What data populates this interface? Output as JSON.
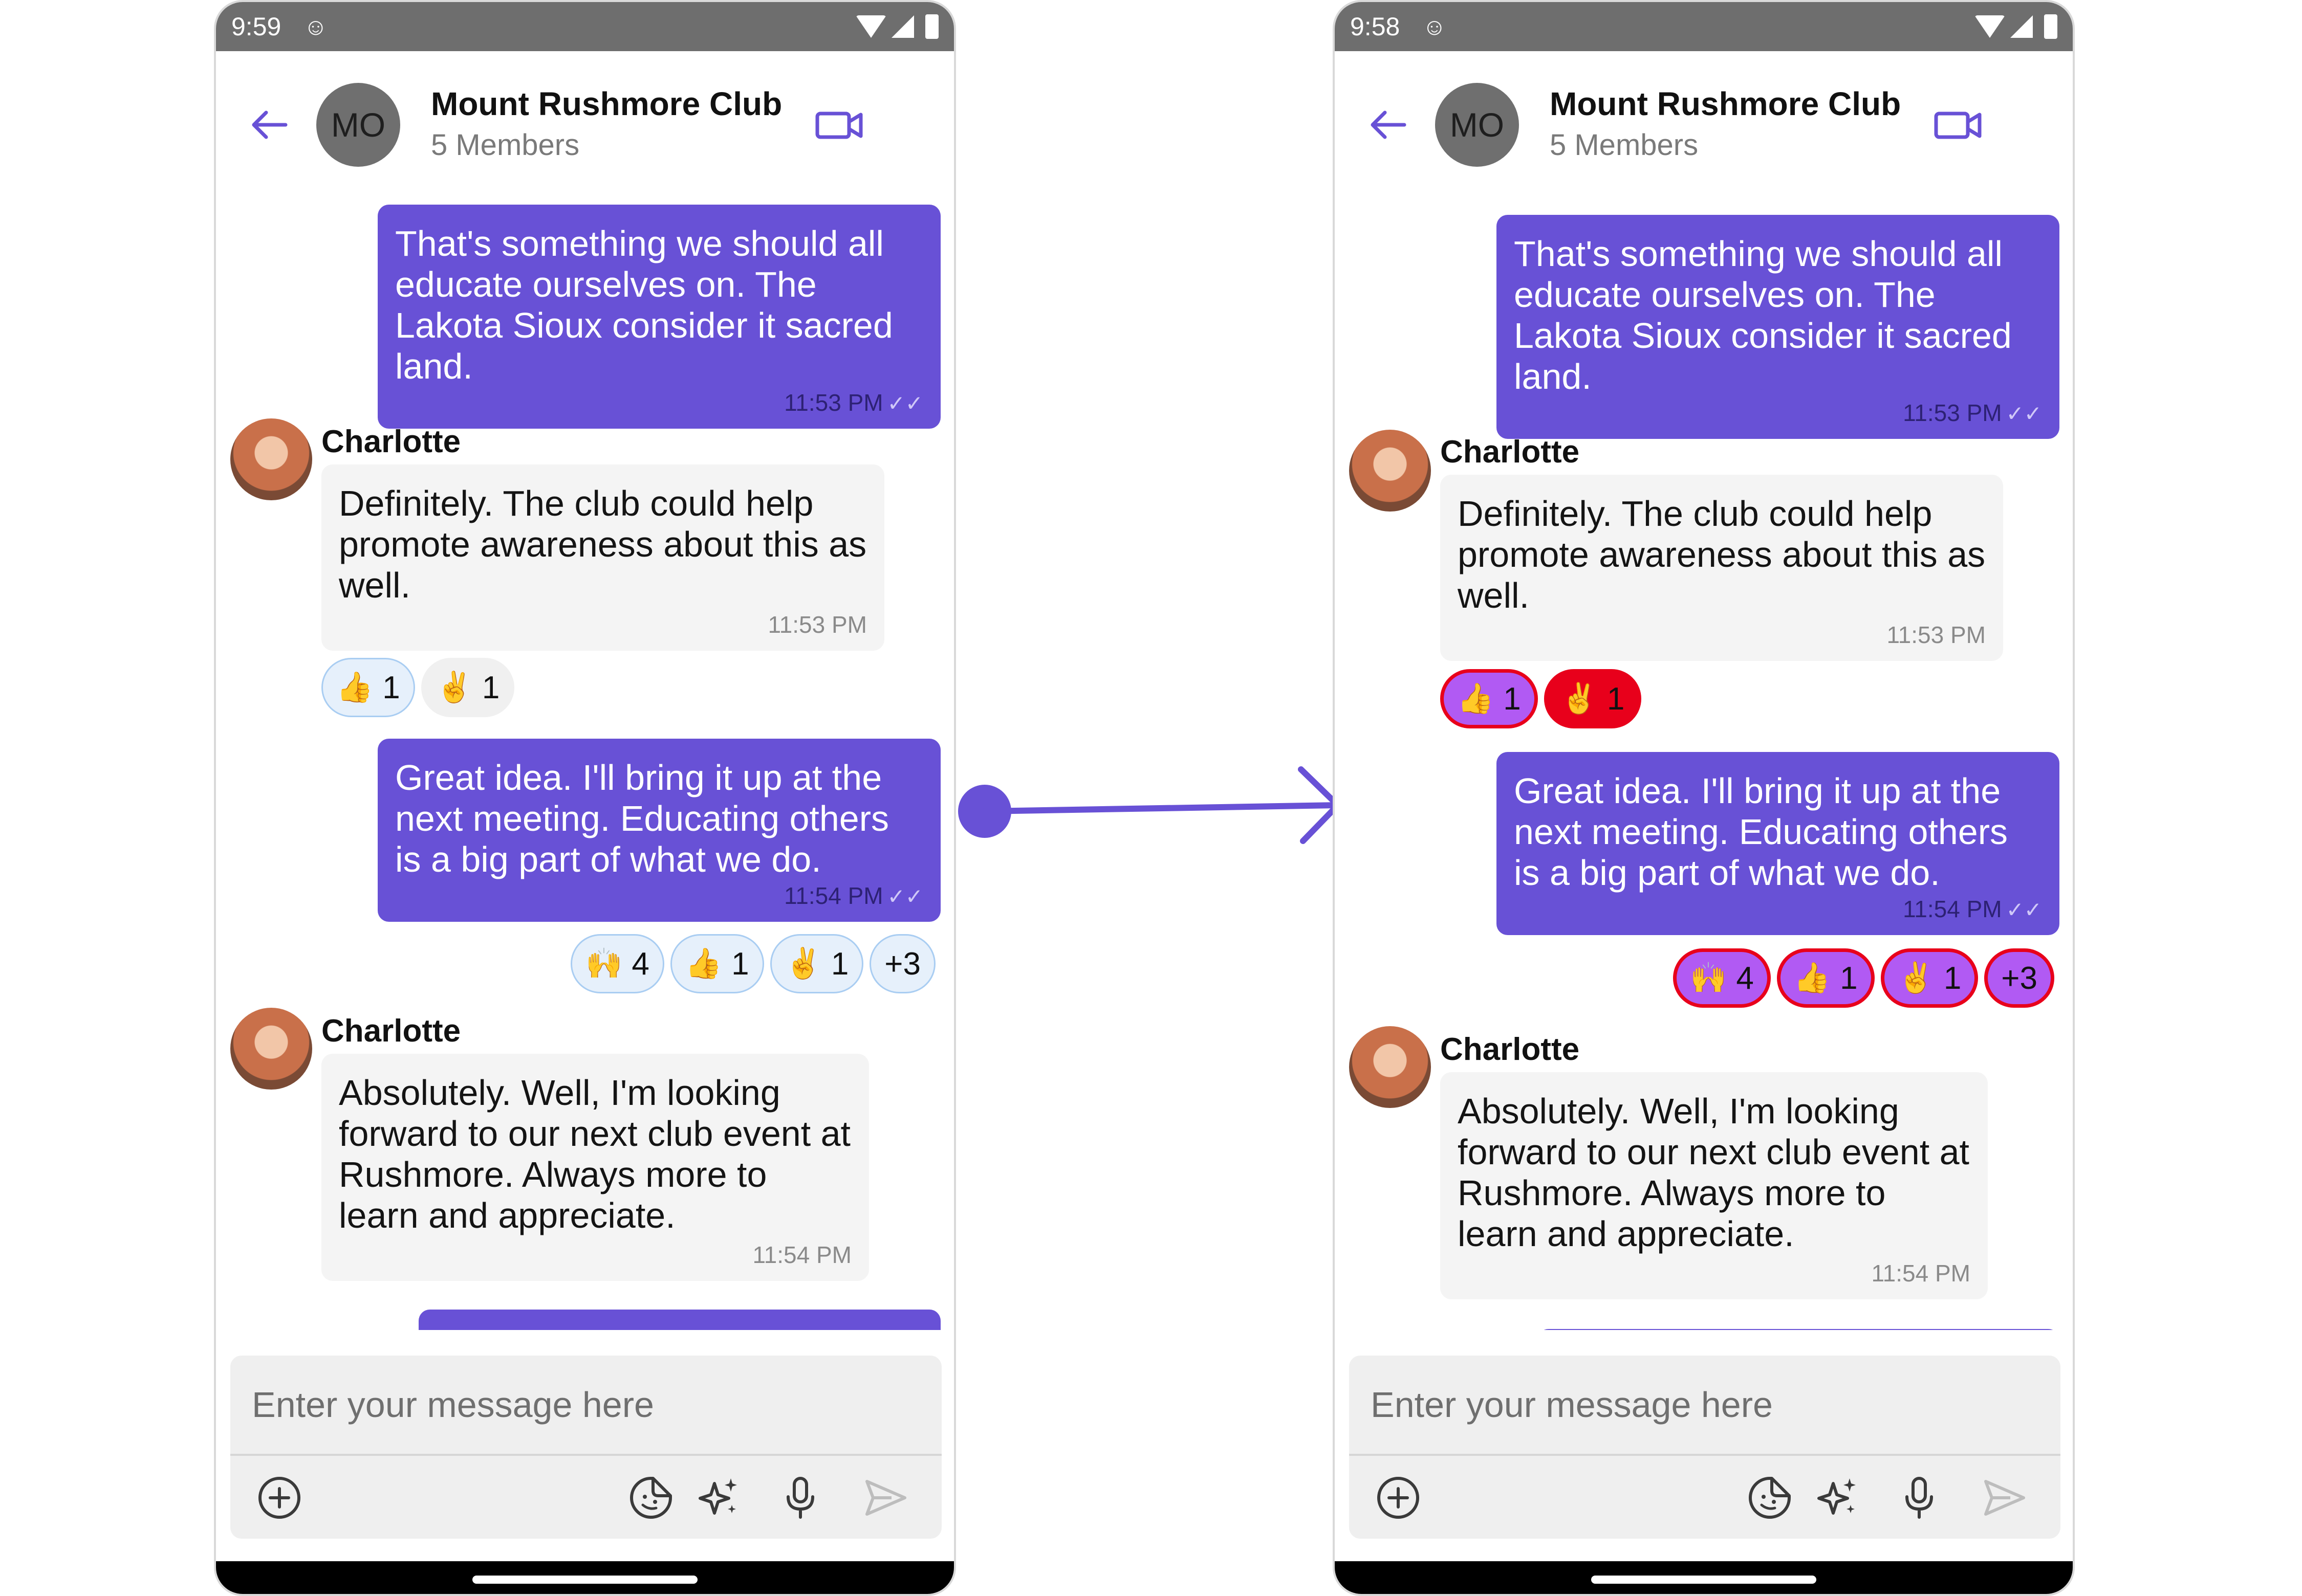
{
  "screens": {
    "left": {
      "status_time": "9:59",
      "group_avatar_initials": "MO",
      "group_name": "Mount Rushmore Club",
      "group_members": "5 Members",
      "messages": [
        {
          "text": "That's something we should all educate ourselves on. The Lakota Sioux consider it sacred land.",
          "time": "11:53 PM"
        },
        {
          "sender": "Charlotte",
          "text": "Definitely. The club could help promote awareness about this as well.",
          "time": "11:53 PM"
        },
        {
          "text": "Great idea. I'll bring it up at the next meeting. Educating others is a big part of what we do.",
          "time": "11:54 PM"
        },
        {
          "sender": "Charlotte",
          "text": "Absolutely. Well, I'm looking forward to our next club event at Rushmore. Always more to learn and appreciate.",
          "time": "11:54 PM"
        }
      ],
      "reactions_msg2": [
        {
          "emoji": "👍",
          "count": "1"
        },
        {
          "emoji": "✌️",
          "count": "1"
        }
      ],
      "reactions_msg3": [
        {
          "emoji": "🙌",
          "count": "4"
        },
        {
          "emoji": "👍",
          "count": "1"
        },
        {
          "emoji": "✌️",
          "count": "1"
        },
        {
          "more": "+3"
        }
      ],
      "composer_placeholder": "Enter your message here"
    },
    "right": {
      "status_time": "9:58",
      "group_avatar_initials": "MO",
      "group_name": "Mount Rushmore Club",
      "group_members": "5 Members",
      "messages": [
        {
          "text": "That's something we should all educate ourselves on. The Lakota Sioux consider it sacred land.",
          "time": "11:53 PM"
        },
        {
          "sender": "Charlotte",
          "text": "Definitely. The club could help promote awareness about this as well.",
          "time": "11:53 PM"
        },
        {
          "text": "Great idea. I'll bring it up at the next meeting. Educating others is a big part of what we do.",
          "time": "11:54 PM"
        },
        {
          "sender": "Charlotte",
          "text": "Absolutely. Well, I'm looking forward to our next club event at Rushmore. Always more to learn and appreciate.",
          "time": "11:54 PM"
        }
      ],
      "reactions_msg2": [
        {
          "emoji": "👍",
          "count": "1"
        },
        {
          "emoji": "✌️",
          "count": "1"
        }
      ],
      "reactions_msg3": [
        {
          "emoji": "🙌",
          "count": "4"
        },
        {
          "emoji": "👍",
          "count": "1"
        },
        {
          "emoji": "✌️",
          "count": "1"
        },
        {
          "more": "+3"
        }
      ],
      "composer_placeholder": "Enter your message here"
    }
  },
  "icons": {
    "back": "arrow-left-icon",
    "video_call": "video-camera-icon",
    "attach": "plus-circle-icon",
    "sticker": "sticker-icon",
    "ai": "sparkles-icon",
    "microphone": "microphone-icon",
    "send": "send-icon",
    "message_status": "double-check-icon"
  },
  "colors": {
    "accent": "#6851d6",
    "outgoing_bubble": "#6851d6",
    "incoming_bubble": "#f4f4f4",
    "reaction_default_bg": "#e6f0fb",
    "reaction_default_border": "#a9cdf2",
    "reaction_custom_bg": "#b15af3",
    "reaction_custom_border": "#e8001b"
  }
}
